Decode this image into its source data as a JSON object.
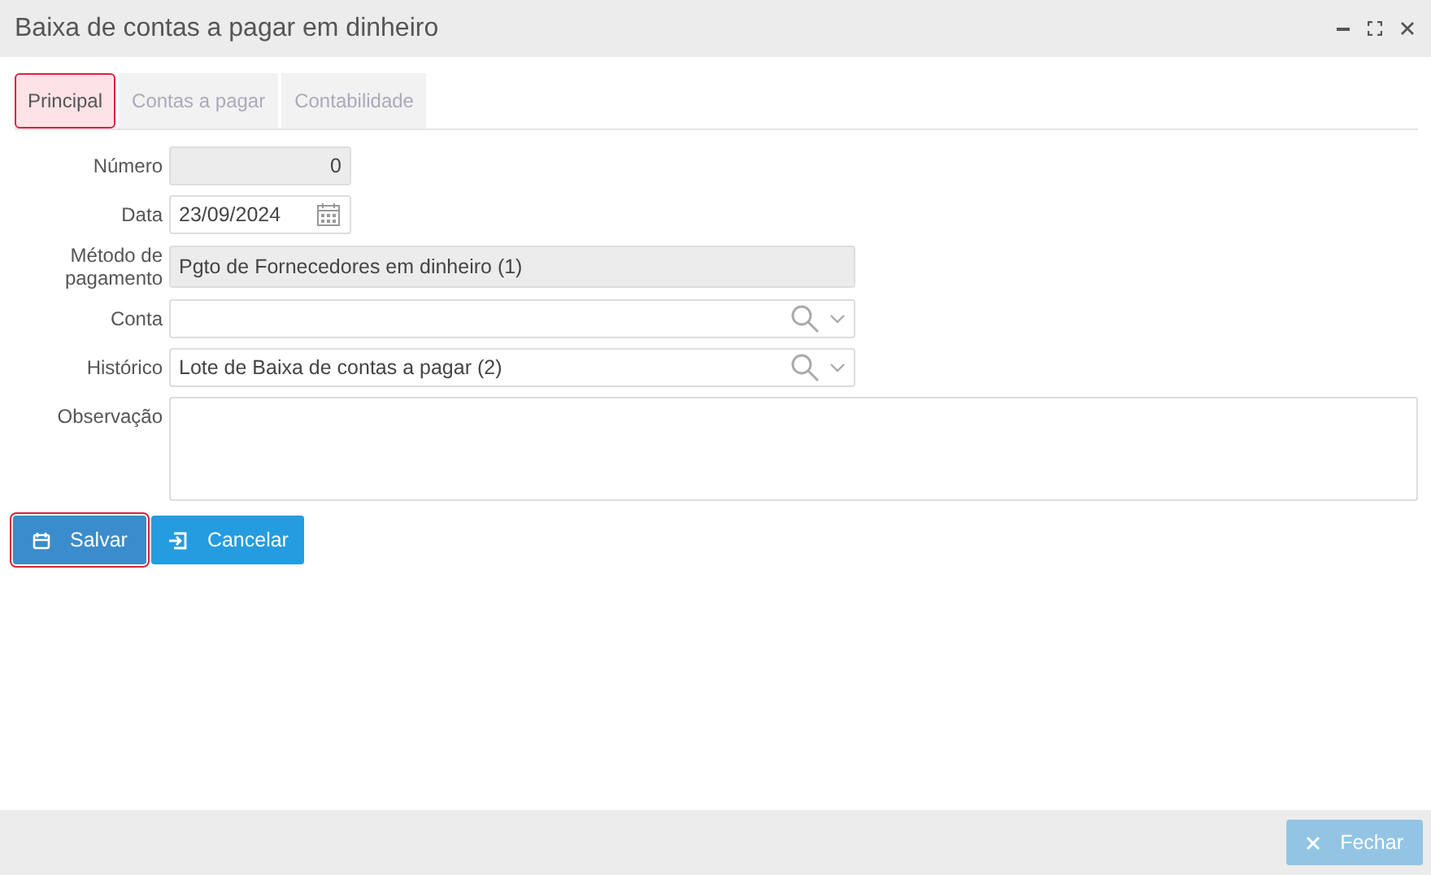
{
  "window": {
    "title": "Baixa de contas a pagar em dinheiro"
  },
  "tabs": [
    {
      "label": "Principal",
      "selected": true
    },
    {
      "label": "Contas a pagar",
      "selected": false
    },
    {
      "label": "Contabilidade",
      "selected": false
    }
  ],
  "fields": [
    {
      "kind": "number",
      "label": "Número",
      "value": "0",
      "disabled": true
    },
    {
      "kind": "date",
      "label": "Data",
      "value": "23/09/2024",
      "disabled": false
    },
    {
      "kind": "text",
      "label": "Método de pagamento",
      "value": "Pgto de Fornecedores em dinheiro (1)",
      "disabled": true
    },
    {
      "kind": "lookup",
      "label": "Conta",
      "disabled": false
    },
    {
      "kind": "lookup",
      "label": "Histórico",
      "value": "Lote de Baixa de contas a pagar (2)",
      "disabled": false
    },
    {
      "kind": "memo",
      "label": "Observação",
      "disabled": false
    }
  ],
  "buttons": [
    {
      "kind": "save",
      "label": "Salvar",
      "focused": true
    },
    {
      "kind": "cancel",
      "label": "Cancelar",
      "focused": false
    }
  ],
  "footer": {
    "close_button": {
      "label": "Fechar",
      "disabled": true
    }
  }
}
